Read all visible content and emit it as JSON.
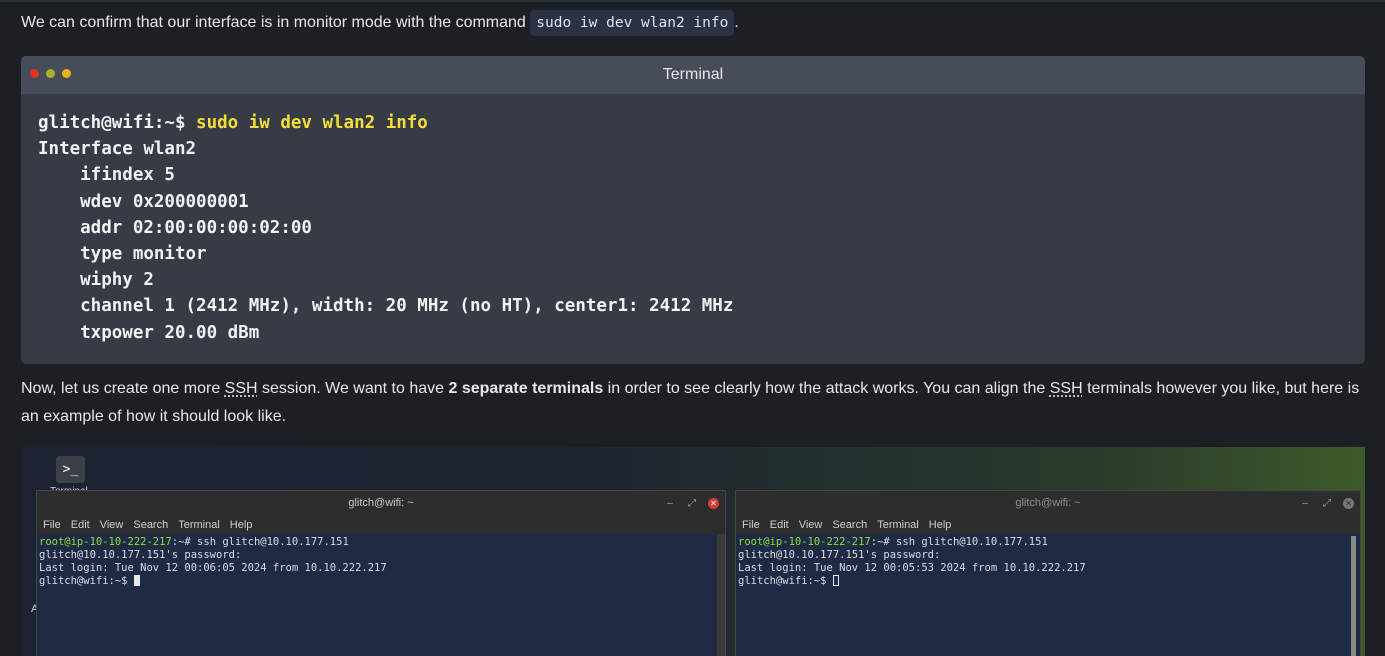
{
  "intro": {
    "text_before": "We can confirm that our interface is in monitor mode with the command ",
    "code": "sudo iw dev wlan2 info",
    "text_after": "."
  },
  "terminal": {
    "title": "Terminal",
    "prompt": "glitch@wifi:~$ ",
    "command": "sudo iw dev wlan2 info",
    "output": [
      "Interface wlan2",
      "    ifindex 5",
      "    wdev 0x200000001",
      "    addr 02:00:00:00:02:00",
      "    type monitor",
      "    wiphy 2",
      "    channel 1 (2412 MHz), width: 20 MHz (no HT), center1: 2412 MHz",
      "    txpower 20.00 dBm"
    ]
  },
  "body": {
    "p1": "Now, let us create one more ",
    "ssh1": "SSH",
    "p2": " session. We want to have ",
    "bold": "2 separate terminals",
    "p3": " in order to see clearly how the attack works. You can align the ",
    "ssh2": "SSH",
    "p4": " terminals however you like, but here is an example of how it should look like."
  },
  "screenshot": {
    "desktop_icon_label": "Terminal",
    "desktop_letter": "A",
    "left_window": {
      "title": "glitch@wifi: ~",
      "menu": [
        "File",
        "Edit",
        "View",
        "Search",
        "Terminal",
        "Help"
      ],
      "root_prompt": "root@ip-10-10-222-217",
      "root_cmd": ":~# ssh glitch@10.10.177.151",
      "line2": "glitch@10.10.177.151's password:",
      "line3": "Last login: Tue Nov 12 00:06:05 2024 from 10.10.222.217",
      "line4": "glitch@wifi:~$ "
    },
    "right_window": {
      "title": "glitch@wifi: ~",
      "menu": [
        "File",
        "Edit",
        "View",
        "Search",
        "Terminal",
        "Help"
      ],
      "root_prompt": "root@ip-10-10-222-217",
      "root_cmd": ":~# ssh glitch@10.10.177.151",
      "line2": "glitch@10.10.177.151's password:",
      "line3": "Last login: Tue Nov 12 00:05:53 2024 from 10.10.222.217",
      "line4": "glitch@wifi:~$ "
    }
  }
}
